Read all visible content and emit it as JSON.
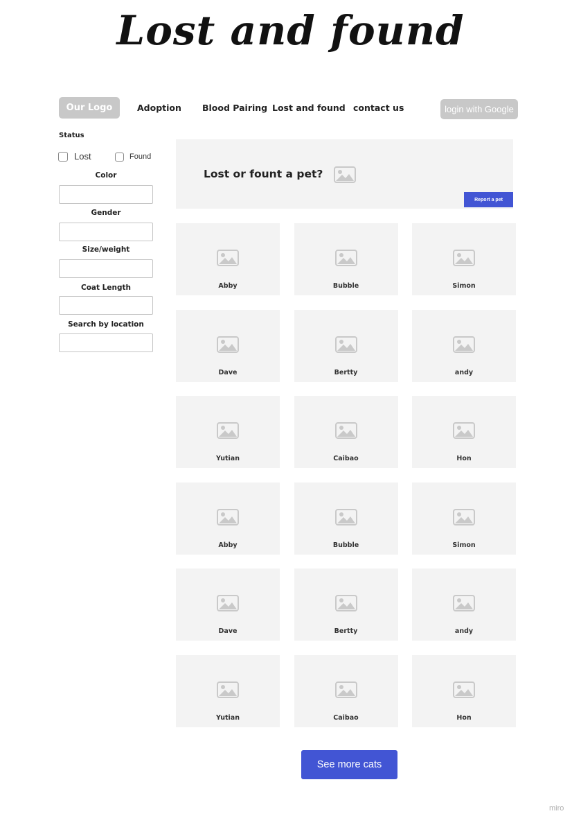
{
  "header": {
    "title": "Lost and found"
  },
  "nav": {
    "logo": "Our Logo",
    "links": [
      "Adoption",
      "Blood Pairing",
      "Lost and found",
      "contact us"
    ],
    "login": "login with Google"
  },
  "filters": {
    "status_label": "Status",
    "lost_label": "Lost",
    "found_label": "Found",
    "fields": [
      "Color",
      "Gender",
      "Size/weight",
      "Coat Length",
      "Search by location"
    ]
  },
  "hero": {
    "text": "Lost or fount a pet?",
    "report_label": "Report a pet"
  },
  "cards": [
    "Abby",
    "Bubble",
    "Simon",
    "Dave",
    "Bertty",
    "andy",
    "Yutian",
    "Caibao",
    "Hon",
    "Abby",
    "Bubble",
    "Simon",
    "Dave",
    "Bertty",
    "andy",
    "Yutian",
    "Caibao",
    "Hon"
  ],
  "more_label": "See more cats",
  "watermark": "miro",
  "colors": {
    "accent": "#4255d4",
    "placeholder_bg": "#f3f3f3",
    "muted_button": "#c8c8c8"
  },
  "icons": {
    "image_placeholder": "image-placeholder-icon"
  }
}
